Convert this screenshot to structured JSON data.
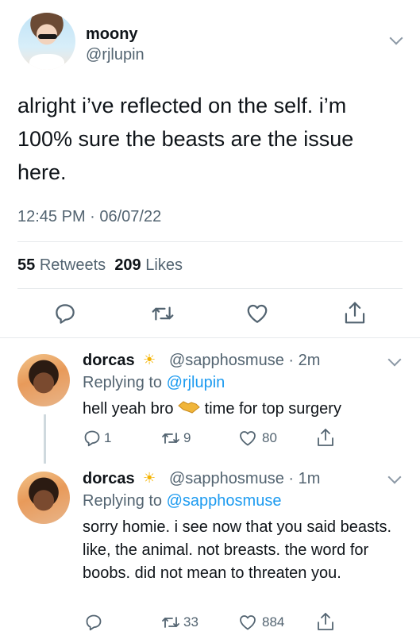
{
  "main_tweet": {
    "name": "moony",
    "handle": "@rjlupin",
    "text": "alright i’ve reflected on the self. i’m 100% sure the beasts are the issue here.",
    "timestamp": "12:45 PM · 06/07/22",
    "retweets_count": "55",
    "retweets_label": "Retweets",
    "likes_count": "209",
    "likes_label": "Likes"
  },
  "replies": [
    {
      "name": "dorcas",
      "emoji": "☀",
      "meta": "@sapphosmuse · 2m",
      "replying_prefix": "Replying to",
      "replying_to": "@rjlupin",
      "text_before": "hell yeah bro",
      "text_after": "time for top surgery",
      "reply_count": "1",
      "retweet_count": "9",
      "like_count": "80"
    },
    {
      "name": "dorcas",
      "emoji": "☀",
      "meta": "@sapphosmuse · 1m",
      "replying_prefix": "Replying to",
      "replying_to": "@sapphosmuse",
      "text": "sorry homie. i see now that you said beasts. like, the animal. not breasts. the word for boobs. did not mean to threaten you.",
      "retweet_count": "33",
      "like_count": "884"
    }
  ],
  "icons": [
    "reply-icon",
    "retweet-icon",
    "like-icon",
    "share-icon",
    "chevron-down-icon",
    "sun-emoji-icon",
    "handshake-emoji-icon"
  ],
  "colors": {
    "link": "#1d9bf0",
    "secondary_text": "#536471",
    "primary_text": "#0f1419"
  }
}
